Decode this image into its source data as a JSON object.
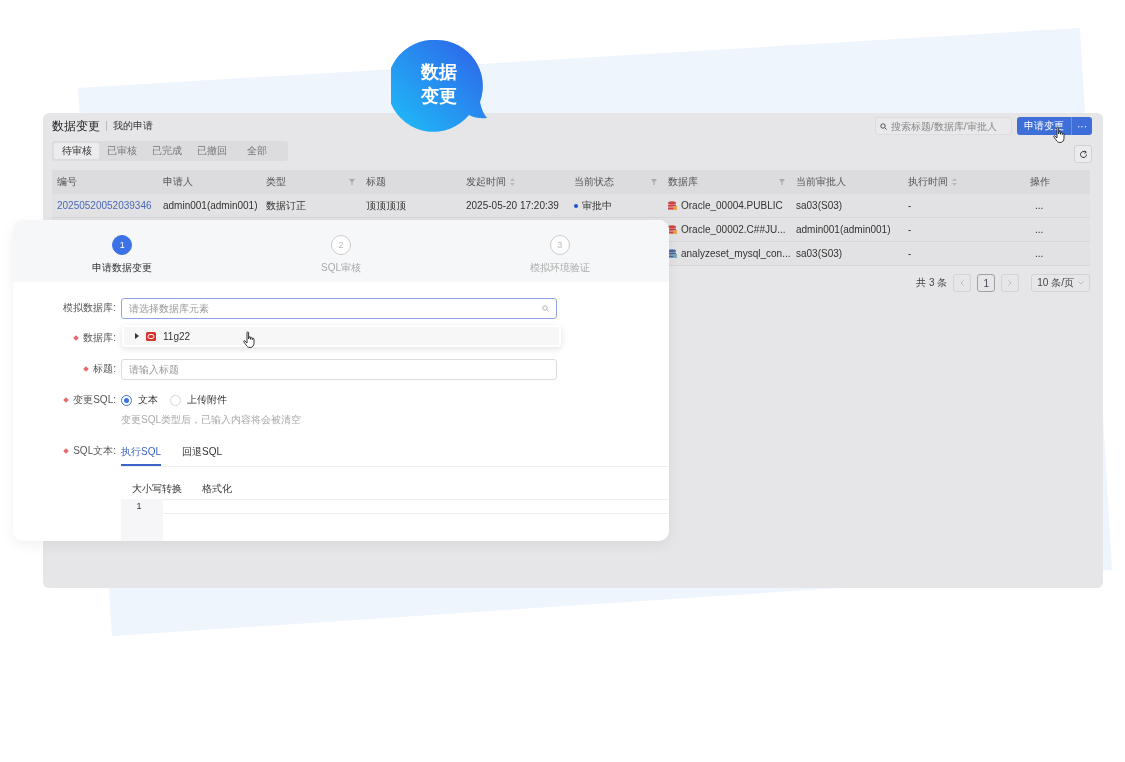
{
  "bubble": {
    "text": "数据变更"
  },
  "header": {
    "title": "数据变更",
    "subtitle": "我的申请"
  },
  "search": {
    "placeholder": "搜索标题/数据库/审批人"
  },
  "primary_button": {
    "label": "申请变更"
  },
  "more_button": {
    "label": "···"
  },
  "tabs": [
    {
      "label": "待审核",
      "selected": true
    },
    {
      "label": "已审核",
      "selected": false
    },
    {
      "label": "已完成",
      "selected": false
    },
    {
      "label": "已撤回",
      "selected": false
    },
    {
      "label": "全部",
      "selected": false
    }
  ],
  "table": {
    "columns": [
      {
        "label": "编号",
        "kind": "plain"
      },
      {
        "label": "申请人",
        "kind": "plain"
      },
      {
        "label": "类型",
        "kind": "filter"
      },
      {
        "label": "标题",
        "kind": "plain"
      },
      {
        "label": "发起时间",
        "kind": "sort"
      },
      {
        "label": "当前状态",
        "kind": "filter"
      },
      {
        "label": "数据库",
        "kind": "filter"
      },
      {
        "label": "当前审批人",
        "kind": "plain"
      },
      {
        "label": "执行时间",
        "kind": "sort"
      },
      {
        "label": "操作",
        "kind": "plain"
      }
    ],
    "rows": [
      {
        "id": "20250520052039346",
        "applicant": "admin001(admin001)",
        "type": "数据订正",
        "title": "顶顶顶顶",
        "time": "2025-05-20 17:20:39",
        "status": "审批中",
        "color": "#1f4fd1",
        "database": {
          "text": "Oracle_00004.PUBLIC",
          "kind": "oracle"
        },
        "approver": "sa03(S03)",
        "exec_time": "-",
        "action": "..."
      },
      {
        "database": {
          "text": "Oracle_00002.C##JU...",
          "kind": "oracle"
        },
        "approver": "admin001(admin001)",
        "exec_time": "-",
        "action": "..."
      },
      {
        "database": {
          "text": "analyzeset_mysql_con...",
          "kind": "mysql"
        },
        "approver": "sa03(S03)",
        "exec_time": "-",
        "action": "..."
      }
    ]
  },
  "pagination": {
    "total": "共 3 条",
    "pages": [
      {
        "label": "1",
        "selected": true
      }
    ],
    "page_size": "10 条/页"
  },
  "form": {
    "steps": [
      {
        "number": "1",
        "label": "申请数据变更",
        "selected": true
      },
      {
        "number": "2",
        "label": "SQL审核",
        "selected": false
      },
      {
        "number": "3",
        "label": "模拟环境验证",
        "selected": false
      }
    ],
    "fields": [
      {
        "kind": "select",
        "label": "模拟数据库:",
        "required": false,
        "placeholder": "请选择数据库元素"
      },
      {
        "kind": "covered",
        "label": "数据库:",
        "required": true
      },
      {
        "kind": "input",
        "label": "标题:",
        "required": true,
        "placeholder": "请输入标题"
      },
      {
        "kind": "radio",
        "label": "变更SQL:",
        "required": true,
        "options": [
          {
            "label": "文本",
            "selected": true
          },
          {
            "label": "上传附件",
            "selected": false
          }
        ],
        "hint": "变更SQL类型后，已输入内容将会被清空"
      },
      {
        "kind": "sql",
        "label": "SQL文本:",
        "required": true,
        "tabs": [
          {
            "label": "执行SQL",
            "selected": true
          },
          {
            "label": "回退SQL",
            "selected": false
          }
        ],
        "toolbar": [
          "大小写转换",
          "格式化"
        ],
        "line_numbers": [
          "1"
        ]
      }
    ],
    "dropdown": {
      "items": [
        {
          "label": "11g22",
          "expanded": false
        }
      ]
    }
  }
}
